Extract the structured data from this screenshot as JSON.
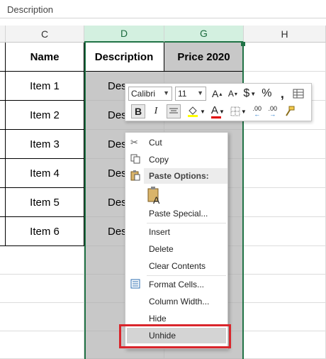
{
  "formula_bar": {
    "text": "Description"
  },
  "columns": [
    "C",
    "D",
    "G",
    "H"
  ],
  "table": {
    "headers": [
      "Name",
      "Description",
      "Price 2020"
    ],
    "rows": [
      {
        "name": "Item 1",
        "desc": "Des"
      },
      {
        "name": "Item 2",
        "desc": "Des"
      },
      {
        "name": "Item 3",
        "desc": "Des"
      },
      {
        "name": "Item 4",
        "desc": "Des"
      },
      {
        "name": "Item 5",
        "desc": "Des"
      },
      {
        "name": "Item 6",
        "desc": "Des"
      }
    ]
  },
  "mini_toolbar": {
    "font": "Calibri",
    "size": "11",
    "bold": "B",
    "italic": "I",
    "currency": "$",
    "percent": "%",
    "comma": ",",
    "font_color_letter": "A",
    "grow_font": "A",
    "shrink_font": "A",
    "inc_decimal": ".00",
    "dec_decimal": ".00"
  },
  "context_menu": {
    "cut": "Cut",
    "copy": "Copy",
    "paste_options": "Paste Options:",
    "paste_special": "Paste Special...",
    "insert": "Insert",
    "delete": "Delete",
    "clear_contents": "Clear Contents",
    "format_cells": "Format Cells...",
    "column_width": "Column Width...",
    "hide": "Hide",
    "unhide": "Unhide"
  },
  "colors": {
    "selection": "#217346",
    "highlight_box": "#d9262c",
    "gray_cell": "#c8c8c8"
  }
}
